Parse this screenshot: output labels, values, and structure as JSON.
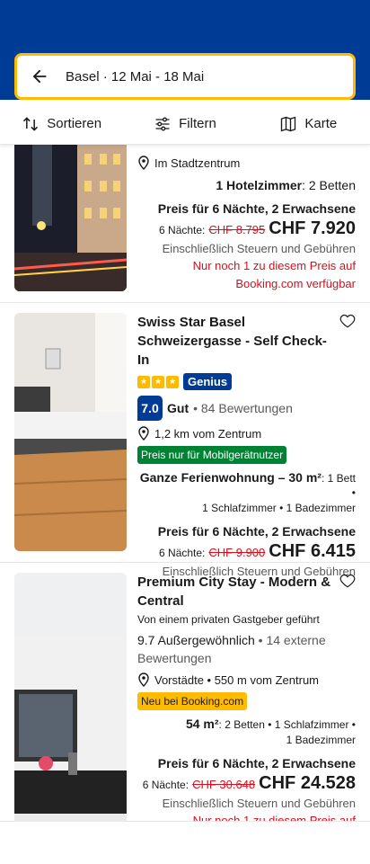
{
  "search": {
    "text": "Basel · 12 Mai - 18 Mai"
  },
  "toolbar": {
    "sort": "Sortieren",
    "filter": "Filtern",
    "map": "Karte"
  },
  "listing1": {
    "location": "Im Stadtzentrum",
    "rooms_bold": "1 Hotelzimmer",
    "rooms_rest": ": 2 Betten",
    "price_head": "Preis für 6 Nächte, 2 Erwachsene",
    "nights": "6 Nächte:",
    "old_price": "CHF 8.795",
    "price": "CHF 7.920",
    "taxes": "Einschließlich Steuern und Gebühren",
    "warning": "Nur noch 1 zu diesem Preis auf Booking.com verfügbar"
  },
  "listing2": {
    "title": "Swiss Star Basel Schweizergasse - Self Check-In",
    "genius": "Genius",
    "score": "7.0",
    "score_label": "Gut",
    "reviews": "• 84 Bewertungen",
    "distance": "1,2 km vom Zentrum",
    "badge": "Preis nur für Mobilgerätnutzer",
    "unit_bold": "Ganze Ferienwohnung – 30 m²",
    "unit_line1_rest": ": 1 Bett •",
    "unit_line2": "1 Schlafzimmer • 1 Badezimmer",
    "price_head": "Preis für 6 Nächte, 2 Erwachsene",
    "nights": "6 Nächte:",
    "old_price": "CHF 9.900",
    "price": "CHF 6.415",
    "taxes": "Einschließlich Steuern und Gebühren"
  },
  "listing3": {
    "title": "Premium City Stay - Modern & Central",
    "host": "Von einem privaten Gastgeber geführt",
    "score": "9.7",
    "score_label": "Außergewöhnlich",
    "reviews_line1": "• 14 externe",
    "reviews_line2": "Bewertungen",
    "location": "Vorstädte • 550 m vom Zentrum",
    "badge": "Neu bei Booking.com",
    "unit_bold": "54 m²",
    "unit_line1_rest": ": 2 Betten • 1 Schlafzimmer •",
    "unit_line2": "1 Badezimmer",
    "price_head": "Preis für 6 Nächte, 2 Erwachsene",
    "nights": "6 Nächte:",
    "old_price": "CHF 30.648",
    "price": "CHF 24.528",
    "taxes": "Einschließlich Steuern und Gebühren",
    "warning_partial": "Nur noch 1 zu diesem Preis auf"
  },
  "colors": {
    "brand": "#003b95",
    "accent": "#febb02",
    "deal": "#d4111e",
    "mobile_badge": "#008234"
  }
}
